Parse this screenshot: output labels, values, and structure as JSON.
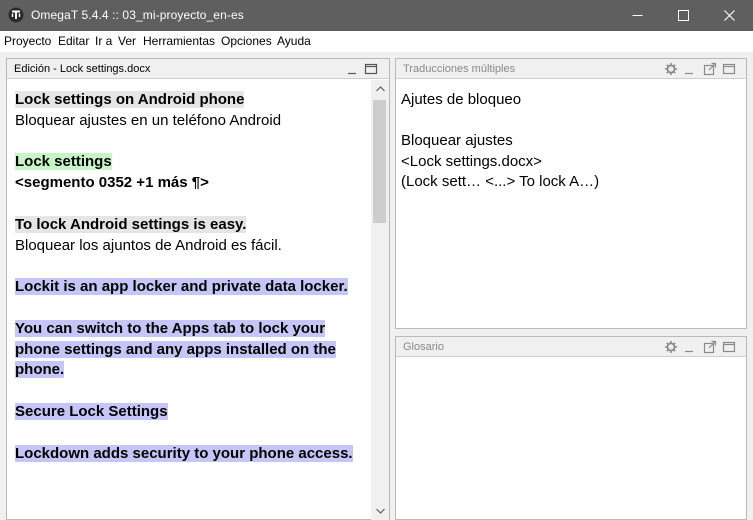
{
  "window": {
    "title": "OmegaT 5.4.4 :: 03_mi-proyecto_en-es",
    "icons": {
      "app": "omegat-logo-icon",
      "minimize": "minimize-icon",
      "maximize": "maximize-icon",
      "close": "close-icon"
    }
  },
  "menu": [
    "Proyecto",
    "Editar",
    "Ir a",
    "Ver",
    "Herramientas",
    "Opciones",
    "Ayuda"
  ],
  "editor": {
    "title": "Edición - Lock settings.docx",
    "segments": [
      {
        "source": "Lock settings on Android phone",
        "target": "Bloquear ajustes en un teléfono Android"
      },
      {
        "source": "Lock settings",
        "marker": "<segmento 0352 +1 más ¶>"
      },
      {
        "source": "To lock Android settings is easy.",
        "target": "Bloquear los ajuntos de Android es fácil."
      },
      {
        "source": "Lockit is an app locker and private data locker."
      },
      {
        "source": "You can switch to the Apps tab to lock your phone settings and any apps installed on the phone."
      },
      {
        "source": "Secure Lock Settings"
      },
      {
        "source": "Lockdown adds security to your phone access."
      }
    ]
  },
  "multiple_translations": {
    "title": "Traducciones múltiples",
    "lines": [
      "Ajutes de bloqueo",
      "",
      "Bloquear ajustes",
      "<Lock settings.docx>",
      "(Lock sett… <...> To lock A…)"
    ]
  },
  "glossary": {
    "title": "Glosario"
  },
  "colors": {
    "titlebar": "#5f5f5f",
    "current_segment": "#e5e5e5",
    "active_source": "#c8f5c8",
    "untranslated": "#c5c5f7"
  }
}
